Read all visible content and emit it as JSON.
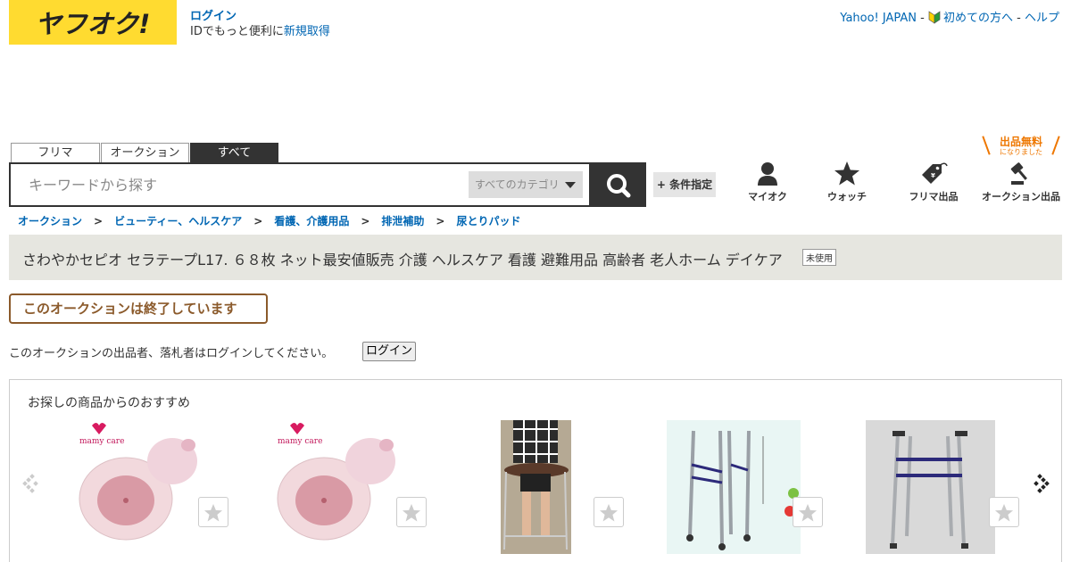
{
  "header": {
    "logo_text": "ヤフオク!",
    "login_link": "ログイン",
    "signup_prefix": "IDでもっと便利に",
    "signup_link": "新規取得",
    "top_links": {
      "yahoo_japan": "Yahoo! JAPAN",
      "sep1": " - ",
      "first_time": "初めての方へ",
      "sep2": " - ",
      "help": "ヘルプ"
    }
  },
  "search": {
    "tabs": [
      {
        "label": "フリマ"
      },
      {
        "label": "オークション"
      },
      {
        "label": "すべて",
        "active": true
      }
    ],
    "placeholder": "キーワードから探す",
    "category": "すべてのカテゴリ",
    "condition_button": "+ 条件指定"
  },
  "nav": {
    "my_auction": "マイオク",
    "watch": "ウォッチ",
    "flea_listing": "フリマ出品",
    "auction_listing": "オークション出品",
    "free_badge_main": "出品無料",
    "free_badge_sub": "になりました"
  },
  "breadcrumbs": [
    "オークション",
    "ビューティー、ヘルスケア",
    "看護、介護用品",
    "排泄補助",
    "尿とりパッド"
  ],
  "breadcrumb_sep": ">",
  "item": {
    "title": "さわやかセピオ セラテープL17. ６８枚 ネット最安値販売 介護 ヘルスケア 看護 避難用品 高齢者 老人ホーム デイケア",
    "condition": "未使用"
  },
  "status": {
    "ended_message": "このオークションは終了しています",
    "login_notice": "このオークションの出品者、落札者はログインしてください。",
    "login_button": "ログイン"
  },
  "recommend": {
    "heading": "お探しの商品からのおすすめ",
    "items": [
      {
        "image": "mamy-care-cushion",
        "brand": "mamy care"
      },
      {
        "image": "mamy-care-cushion",
        "brand": "mamy care"
      },
      {
        "image": "person-in-walker"
      },
      {
        "image": "folding-walker-with-dimensions"
      },
      {
        "image": "folding-walker"
      }
    ]
  },
  "colors": {
    "brand_yellow": "#ffdb30",
    "link_blue": "#0066b3",
    "dark": "#333333",
    "ended_brown": "#8b5a2b",
    "free_orange": "#ee7700"
  }
}
